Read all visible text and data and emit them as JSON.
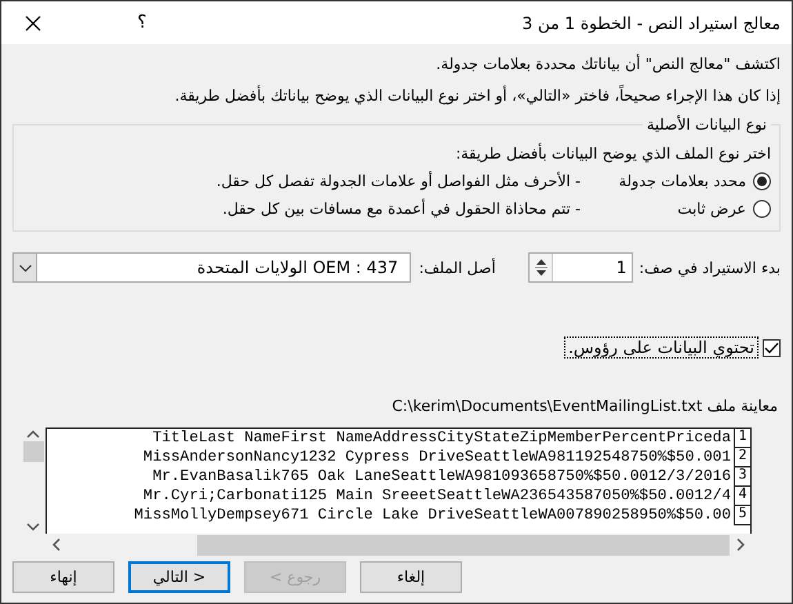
{
  "window": {
    "title": "معالج استيراد النص - الخطوة 1 من 3",
    "help": "؟"
  },
  "intro": [
    "اكتشف \"معالج النص\" أن بياناتك محددة بعلامات جدولة.",
    "إذا كان هذا الإجراء صحيحاً، فاختر «التالي»، أو اختر نوع البيانات الذي يوضح بياناتك بأفضل طريقة."
  ],
  "data_type": {
    "legend": "نوع البيانات الأصلية",
    "prompt": "اختر نوع الملف الذي يوضح البيانات بأفضل طريقة:",
    "options": [
      {
        "label": "محدد بعلامات جدولة",
        "description": "- الأحرف مثل الفواصل أو علامات الجدولة تفصل كل حقل.",
        "selected": true
      },
      {
        "label": "عرض ثابت",
        "description": "- تتم محاذاة الحقول في أعمدة مع مسافات بين كل حقل.",
        "selected": false
      }
    ]
  },
  "start_row": {
    "label": "بدء الاستيراد في صف:",
    "value": "1"
  },
  "file_origin": {
    "label": "أصل الملف:",
    "value": "437 : OEM الولايات المتحدة"
  },
  "headers_checkbox": {
    "label": "تحتوي البيانات على رؤوس.",
    "checked": true
  },
  "preview": {
    "label": "معاينة ملف C:\\kerim\\Documents\\EventMailingList.txt",
    "rows": [
      {
        "number": "1",
        "text": "TitleLast NameFirst NameAddressCityStateZipMemberPercentPriceda"
      },
      {
        "number": "2",
        "text": "MissAndersonNancy1232 Cypress DriveSeattleWA981192548750%$50.001"
      },
      {
        "number": "3",
        "text": "Mr.EvanBasalik765 Oak LaneSeattleWA981093658750%$50.0012/3/2016"
      },
      {
        "number": "4",
        "text": "Mr.Cyri;Carbonati125 Main SreeetSeattleWA236543587050%$50.0012/4"
      },
      {
        "number": "5",
        "text": "MissMollyDempsey671 Circle Lake DriveSeattleWA007890258950%$50.00"
      }
    ]
  },
  "buttons": [
    {
      "label": "إلغاء",
      "disabled": false,
      "default": false
    },
    {
      "label": "< رجوع",
      "disabled": true,
      "default": false
    },
    {
      "label": "التالي >",
      "disabled": false,
      "default": true
    },
    {
      "label": "إنهاء",
      "disabled": false,
      "default": false
    }
  ]
}
